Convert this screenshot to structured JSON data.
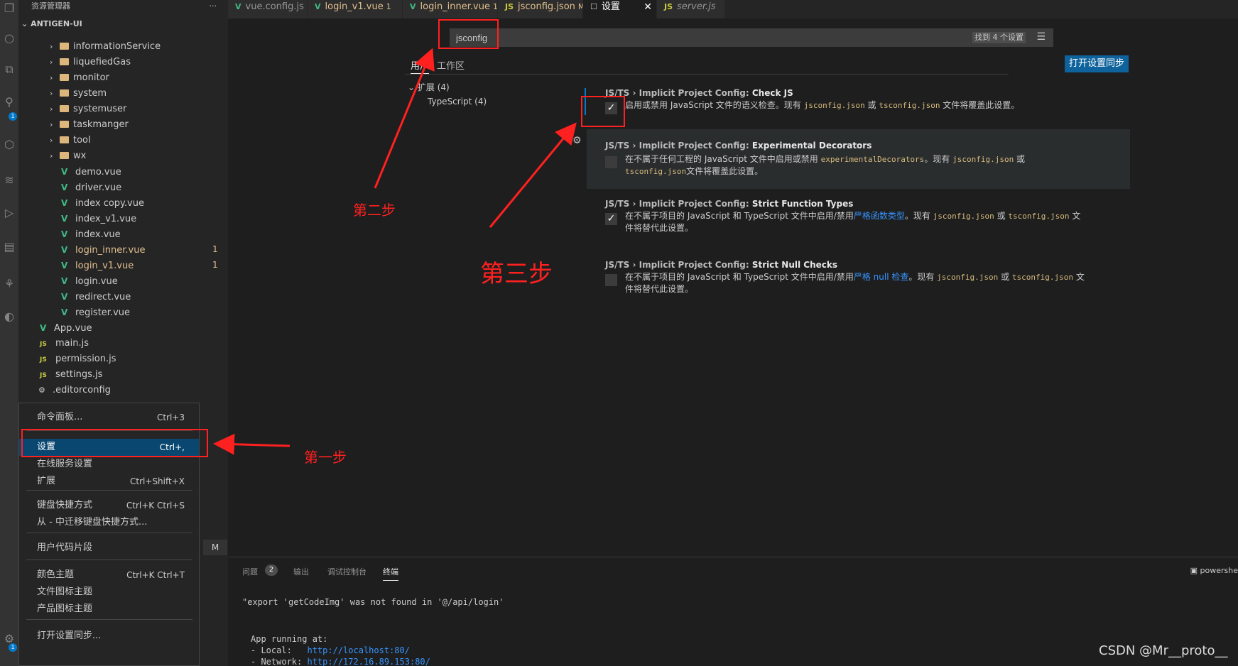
{
  "activity_bar": {
    "icons": [
      "explorer-icon",
      "search-icon",
      "source-control-icon",
      "run-debug-icon",
      "extensions-icon",
      "docker-icon",
      "remote-icon",
      "test-icon",
      "account-icon",
      "settings-gear-icon"
    ],
    "badges": [
      "1",
      "1"
    ]
  },
  "explorer": {
    "header": "资源管理器",
    "more": "···",
    "project": "ANTIGEN-UI",
    "items": [
      {
        "label": "informationService",
        "kind": "folder"
      },
      {
        "label": "liquefiedGas",
        "kind": "folder"
      },
      {
        "label": "monitor",
        "kind": "folder"
      },
      {
        "label": "system",
        "kind": "folder"
      },
      {
        "label": "systemuser",
        "kind": "folder"
      },
      {
        "label": "taskmanger",
        "kind": "folder"
      },
      {
        "label": "tool",
        "kind": "folder"
      },
      {
        "label": "wx",
        "kind": "folder"
      },
      {
        "label": "demo.vue",
        "kind": "vue"
      },
      {
        "label": "driver.vue",
        "kind": "vue"
      },
      {
        "label": "index copy.vue",
        "kind": "vue"
      },
      {
        "label": "index_v1.vue",
        "kind": "vue"
      },
      {
        "label": "index.vue",
        "kind": "vue"
      },
      {
        "label": "login_inner.vue",
        "kind": "vue",
        "count": "1"
      },
      {
        "label": "login_v1.vue",
        "kind": "vue",
        "count": "1"
      },
      {
        "label": "login.vue",
        "kind": "vue"
      },
      {
        "label": "redirect.vue",
        "kind": "vue"
      },
      {
        "label": "register.vue",
        "kind": "vue"
      },
      {
        "label": "App.vue",
        "kind": "vue"
      },
      {
        "label": "main.js",
        "kind": "js"
      },
      {
        "label": "permission.js",
        "kind": "js"
      },
      {
        "label": "settings.js",
        "kind": "js"
      },
      {
        "label": ".editorconfig",
        "kind": "config"
      }
    ]
  },
  "context_menu": {
    "items": [
      {
        "label": "命令面板...",
        "shortcut": "Ctrl+3"
      },
      {
        "label": "设置",
        "shortcut": "Ctrl+,"
      },
      {
        "label": "在线服务设置",
        "shortcut": ""
      },
      {
        "label": "扩展",
        "shortcut": "Ctrl+Shift+X"
      },
      {
        "label": "键盘快捷方式",
        "shortcut": "Ctrl+K Ctrl+S"
      },
      {
        "label": "从 - 中迁移键盘快捷方式...",
        "shortcut": ""
      },
      {
        "label": "用户代码片段",
        "shortcut": ""
      },
      {
        "label": "颜色主题",
        "shortcut": "Ctrl+K Ctrl+T"
      },
      {
        "label": "文件图标主题",
        "shortcut": ""
      },
      {
        "label": "产品图标主题",
        "shortcut": ""
      },
      {
        "label": "打开设置同步...",
        "shortcut": ""
      }
    ],
    "marker": "M"
  },
  "tabs": [
    {
      "icon": "V",
      "label": "vue.config.js",
      "mod": ""
    },
    {
      "icon": "V",
      "label": "login_v1.vue",
      "mod": "1"
    },
    {
      "icon": "V",
      "label": "login_inner.vue",
      "mod": "1"
    },
    {
      "icon": "JS",
      "label": "jsconfig.json",
      "mod": "M"
    },
    {
      "icon": "☐",
      "label": "设置",
      "mod": ""
    },
    {
      "icon": "JS",
      "label": "server.js",
      "mod": ""
    }
  ],
  "settings": {
    "search_value": "jsconfig",
    "search_count": "找到 4 个设置",
    "sync_button": "打开设置同步",
    "tab_user": "用户",
    "tab_workspace": "工作区",
    "toc_extensions": "扩展 (4)",
    "toc_typescript": "TypeScript (4)",
    "items": [
      {
        "category": "JS/TS › Implicit Project Config: ",
        "title": "Check JS",
        "checked": true,
        "desc_a": "启用或禁用 JavaScript 文件的语义检查。现有 ",
        "code1": "jsconfig.json",
        "or": " 或 ",
        "code2": "tsconfig.json",
        "desc_b": " 文件将覆盖此设置。"
      },
      {
        "category": "JS/TS › Implicit Project Config: ",
        "title": "Experimental Decorators",
        "checked": false,
        "desc_a": "在不属于任何工程的 JavaScript 文件中启用或禁用 ",
        "code0": "experimentalDecorators",
        "desc_mid": "。现有 ",
        "code1": "jsconfig.json",
        "or": " 或 ",
        "code2": "tsconfig.json",
        "desc_b": "文件将覆盖此设置。"
      },
      {
        "category": "JS/TS › Implicit Project Config: ",
        "title": "Strict Function Types",
        "checked": true,
        "desc_a": "在不属于项目的 JavaScript 和 TypeScript 文件中启用/禁用",
        "link": "严格函数类型",
        "desc_mid": "。现有 ",
        "code1": "jsconfig.json",
        "or": " 或 ",
        "code2": "tsconfig.json",
        "desc_b": " 文件将替代此设置。"
      },
      {
        "category": "JS/TS › Implicit Project Config: ",
        "title": "Strict Null Checks",
        "checked": false,
        "desc_a": "在不属于项目的 JavaScript 和 TypeScript 文件中启用/禁用",
        "link": "严格 null 检查",
        "desc_mid": "。现有 ",
        "code1": "jsconfig.json",
        "or": " 或 ",
        "code2": "tsconfig.json",
        "desc_b": " 文件将替代此设置。"
      }
    ]
  },
  "panel": {
    "tab_problems": "问题",
    "problems_count": "2",
    "tab_output": "输出",
    "tab_debug": "调试控制台",
    "tab_terminal": "终端",
    "shell": "powershe",
    "line1": "\"export 'getCodeImg' was not found in '@/api/login'",
    "line2": "App running at:",
    "line3_label": "- Local:   ",
    "line3_link": "http://localhost:80/",
    "line4_label": "- Network: ",
    "line4_link": "http://172.16.89.153:80/"
  },
  "annotations": {
    "step1": "第一步",
    "step2": "第二步",
    "step3": "第三步",
    "color": "#ff2020"
  },
  "watermark": "CSDN @Mr__proto__"
}
